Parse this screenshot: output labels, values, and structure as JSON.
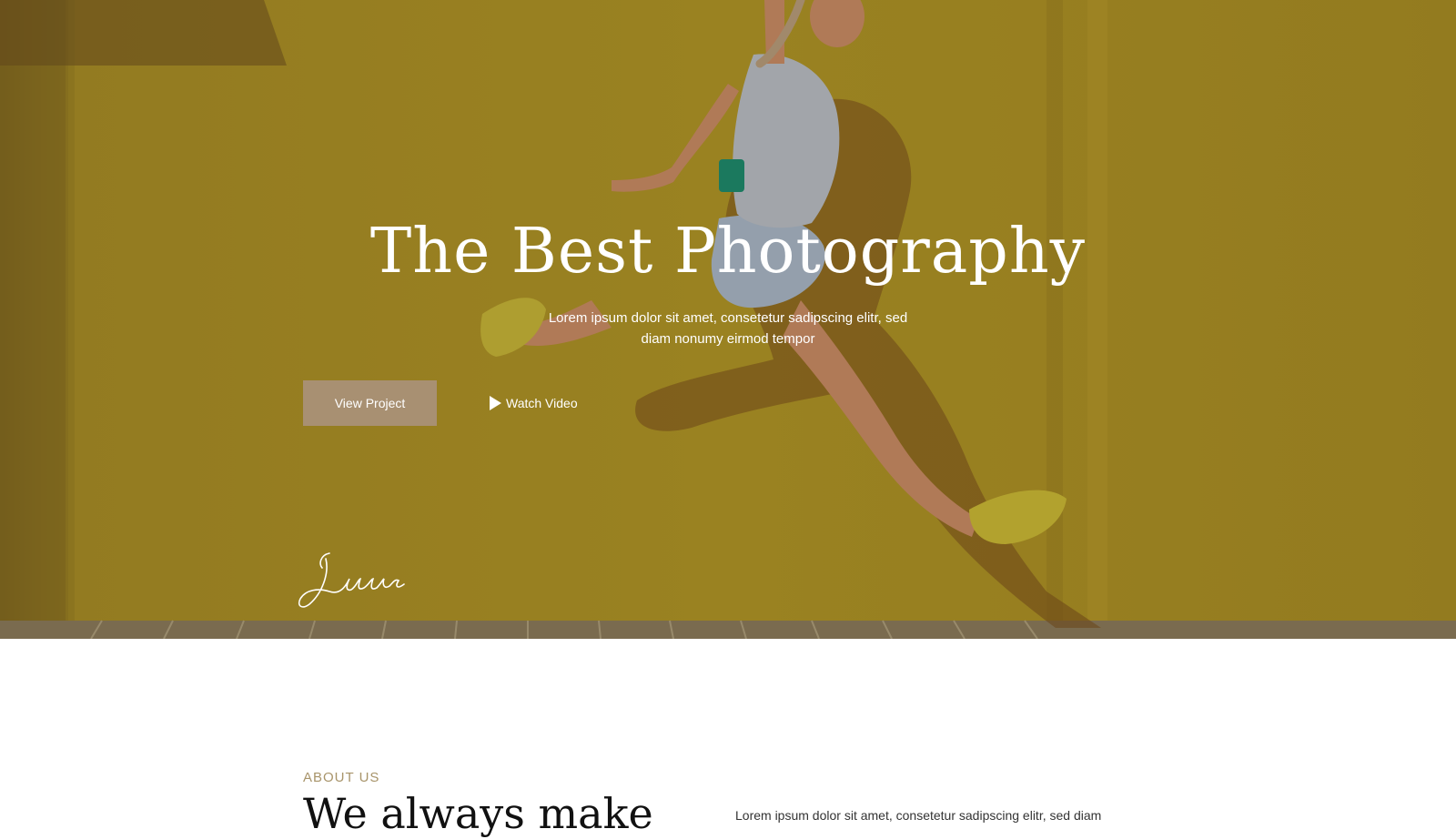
{
  "hero": {
    "title": "The Best Photography",
    "subtitle": "Lorem ipsum dolor sit amet, consetetur sadipscing elitr, sed diam nonumy eirmod tempor",
    "primary_button": "View Project",
    "secondary_button": "Watch Video",
    "signature": "Jessica",
    "overlay_color": "#a38a24"
  },
  "about": {
    "label": "ABOUT US",
    "heading": "We always make",
    "text": "Lorem ipsum dolor sit amet, consetetur sadipscing elitr, sed diam"
  },
  "colors": {
    "accent": "#a89072",
    "label": "#a8946a"
  }
}
